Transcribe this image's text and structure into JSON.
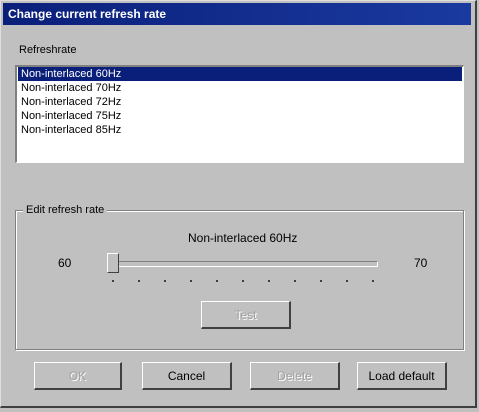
{
  "window": {
    "title": "Change current refresh rate"
  },
  "refresh_label": "Refreshrate",
  "list": {
    "items": [
      "Non-interlaced 60Hz",
      "Non-interlaced 70Hz",
      "Non-interlaced 72Hz",
      "Non-interlaced 75Hz",
      "Non-interlaced 85Hz"
    ],
    "selected_index": 0
  },
  "edit_group": {
    "legend": "Edit refresh rate",
    "current_mode": "Non-interlaced 60Hz",
    "slider_min_label": "60",
    "slider_max_label": "70",
    "slider_value_fraction": 0.0,
    "test_label": "Test"
  },
  "buttons": {
    "ok": "OK",
    "cancel": "Cancel",
    "delete": "Delete",
    "load_default": "Load default"
  },
  "colors": {
    "titlebar": "#0a1f7a",
    "selection": "#0a1f7a",
    "face": "#c0c0c0"
  }
}
